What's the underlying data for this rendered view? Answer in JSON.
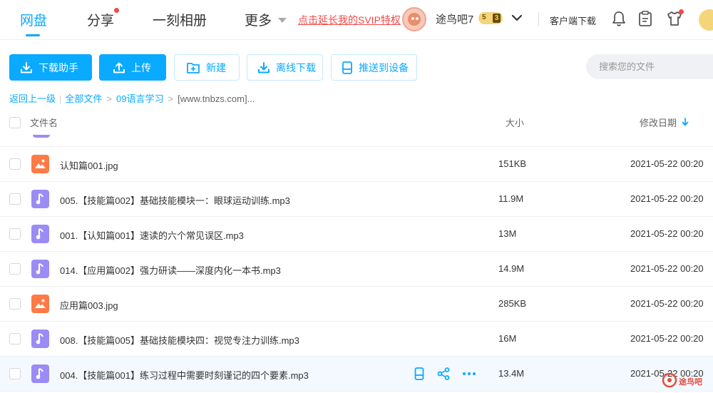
{
  "nav": {
    "items": [
      "网盘",
      "分享",
      "一刻相册",
      "更多"
    ],
    "promo": "点击延长我的SVIP特权",
    "username": "途鸟吧7",
    "vip_level": "5",
    "vip_sub": "3",
    "client_download": "客户端下载"
  },
  "toolbar": {
    "download_helper": "下载助手",
    "upload": "上传",
    "new": "新建",
    "offline_download": "离线下载",
    "push_to_device": "推送到设备",
    "search_placeholder": "搜索您的文件"
  },
  "breadcrumb": {
    "back": "返回上一级",
    "all_files": "全部文件",
    "folder": "09语言学习",
    "current": "[www.tnbzs.com]..."
  },
  "table": {
    "headers": {
      "name": "文件名",
      "size": "大小",
      "date": "修改日期"
    },
    "rows": [
      {
        "type": "image",
        "name": "认知篇001.jpg",
        "size": "151KB",
        "date": "2021-05-22 00:20"
      },
      {
        "type": "audio",
        "name": "005.【技能篇002】基础技能模块一：眼球运动训练.mp3",
        "size": "11.9M",
        "date": "2021-05-22 00:20"
      },
      {
        "type": "audio",
        "name": "001.【认知篇001】速读的六个常见误区.mp3",
        "size": "13M",
        "date": "2021-05-22 00:20"
      },
      {
        "type": "audio",
        "name": "014.【应用篇002】强力研读——深度内化一本书.mp3",
        "size": "14.9M",
        "date": "2021-05-22 00:20"
      },
      {
        "type": "image",
        "name": "应用篇003.jpg",
        "size": "285KB",
        "date": "2021-05-22 00:20"
      },
      {
        "type": "audio",
        "name": "008.【技能篇005】基础技能模块四：视觉专注力训练.mp3",
        "size": "16M",
        "date": "2021-05-22 00:20"
      },
      {
        "type": "audio",
        "name": "004.【技能篇001】练习过程中需要时刻谨记的四个要素.mp3",
        "size": "13.4M",
        "date": "2021-05-22 00:20"
      }
    ]
  },
  "watermark": "途鸟吧",
  "colors": {
    "accent": "#09AAFF",
    "promo": "#F54848",
    "audio_icon": "#9B8BF5",
    "image_icon": "#FF7A45"
  }
}
